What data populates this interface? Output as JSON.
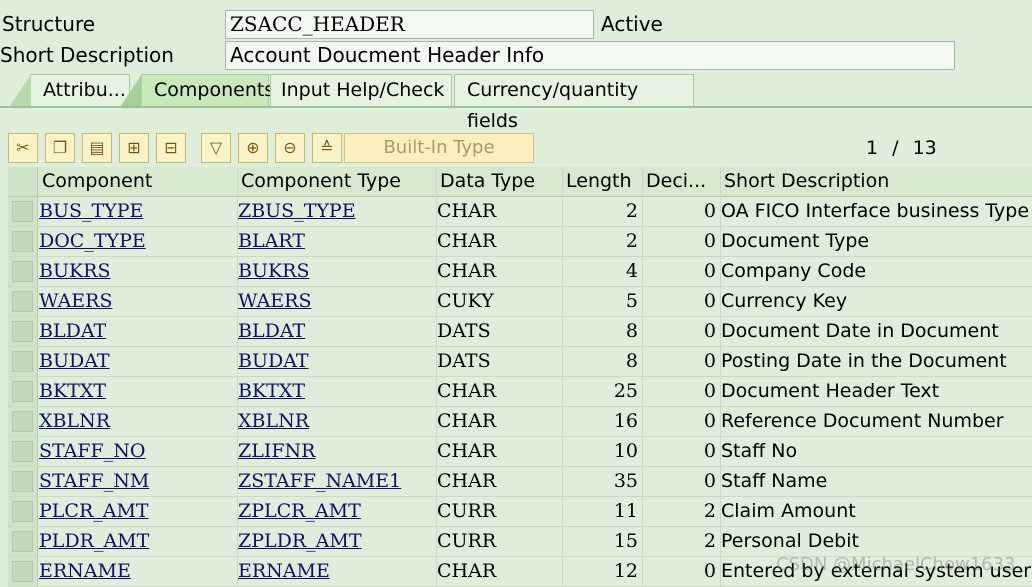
{
  "header": {
    "structure_label": "Structure",
    "structure_value": "ZSACC_HEADER",
    "status": "Active",
    "short_desc_label": "Short Description",
    "short_desc_value": "Account Doucment Header Info"
  },
  "tabs": [
    {
      "label": "Attribu...",
      "active": false
    },
    {
      "label": "Components",
      "active": true
    },
    {
      "label": "Input Help/Check",
      "active": false
    },
    {
      "label": "Currency/quantity fields",
      "active": false
    }
  ],
  "toolbar": {
    "icons": [
      "cut-icon",
      "copy-icon",
      "paste-icon",
      "insert-row-icon",
      "delete-row-icon",
      "filter-icon",
      "expand-icon",
      "collapse-icon",
      "hierarchy-icon"
    ],
    "builtin_label": "Built-In Type"
  },
  "pager": {
    "current": "1",
    "sep": "/",
    "total": "13"
  },
  "table": {
    "columns": [
      "Component",
      "Component Type",
      "Data Type",
      "Length",
      "Deci...",
      "Short Description"
    ],
    "rows": [
      {
        "component": "BUS_TYPE",
        "ctype": "ZBUS_TYPE",
        "dtype": "CHAR",
        "length": "2",
        "dec": "0",
        "desc": "OA FICO Interface business Type"
      },
      {
        "component": "DOC_TYPE",
        "ctype": "BLART",
        "dtype": "CHAR",
        "length": "2",
        "dec": "0",
        "desc": "Document Type"
      },
      {
        "component": "BUKRS",
        "ctype": "BUKRS",
        "dtype": "CHAR",
        "length": "4",
        "dec": "0",
        "desc": "Company Code"
      },
      {
        "component": "WAERS",
        "ctype": "WAERS",
        "dtype": "CUKY",
        "length": "5",
        "dec": "0",
        "desc": "Currency Key"
      },
      {
        "component": "BLDAT",
        "ctype": "BLDAT",
        "dtype": "DATS",
        "length": "8",
        "dec": "0",
        "desc": "Document Date in Document"
      },
      {
        "component": "BUDAT",
        "ctype": "BUDAT",
        "dtype": "DATS",
        "length": "8",
        "dec": "0",
        "desc": "Posting Date in the Document"
      },
      {
        "component": "BKTXT",
        "ctype": "BKTXT",
        "dtype": "CHAR",
        "length": "25",
        "dec": "0",
        "desc": "Document Header Text"
      },
      {
        "component": "XBLNR",
        "ctype": "XBLNR",
        "dtype": "CHAR",
        "length": "16",
        "dec": "0",
        "desc": "Reference Document Number"
      },
      {
        "component": "STAFF_NO",
        "ctype": "ZLIFNR",
        "dtype": "CHAR",
        "length": "10",
        "dec": "0",
        "desc": "Staff No"
      },
      {
        "component": "STAFF_NM",
        "ctype": "ZSTAFF_NAME1",
        "dtype": "CHAR",
        "length": "35",
        "dec": "0",
        "desc": "Staff Name"
      },
      {
        "component": "PLCR_AMT",
        "ctype": "ZPLCR_AMT",
        "dtype": "CURR",
        "length": "11",
        "dec": "2",
        "desc": "Claim Amount"
      },
      {
        "component": "PLDR_AMT",
        "ctype": "ZPLDR_AMT",
        "dtype": "CURR",
        "length": "15",
        "dec": "2",
        "desc": "Personal Debit"
      },
      {
        "component": "ERNAME",
        "ctype": "ERNAME",
        "dtype": "CHAR",
        "length": "12",
        "dec": "0",
        "desc": "Entered by external system user"
      }
    ]
  },
  "watermark": "CSDN @MichaelChow1633"
}
